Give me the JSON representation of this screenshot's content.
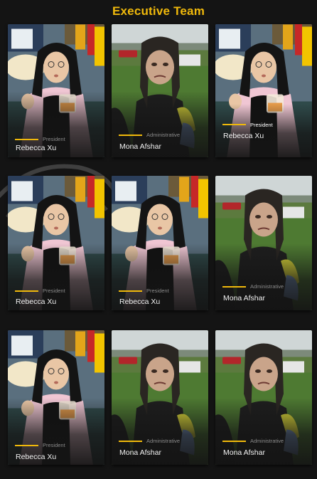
{
  "page": {
    "title": "Executive Team"
  },
  "colors": {
    "accent": "#f0b90b",
    "background": "#141414"
  },
  "team": {
    "row1": [
      {
        "name": "Rebecca Xu",
        "role": "President"
      },
      {
        "name": "Mona Afshar",
        "role": "Administrative"
      },
      {
        "name": "Rebecca Xu",
        "role": "President"
      }
    ],
    "row2": [
      {
        "name": "Rebecca Xu",
        "role": "President"
      },
      {
        "name": "Rebecca Xu",
        "role": "President"
      },
      {
        "name": "Mona Afshar",
        "role": "Administrative"
      }
    ],
    "row3": [
      {
        "name": "Rebecca Xu",
        "role": "President"
      },
      {
        "name": "Mona Afshar",
        "role": "Administrative"
      },
      {
        "name": "Mona Afshar",
        "role": "Administrative"
      }
    ]
  }
}
